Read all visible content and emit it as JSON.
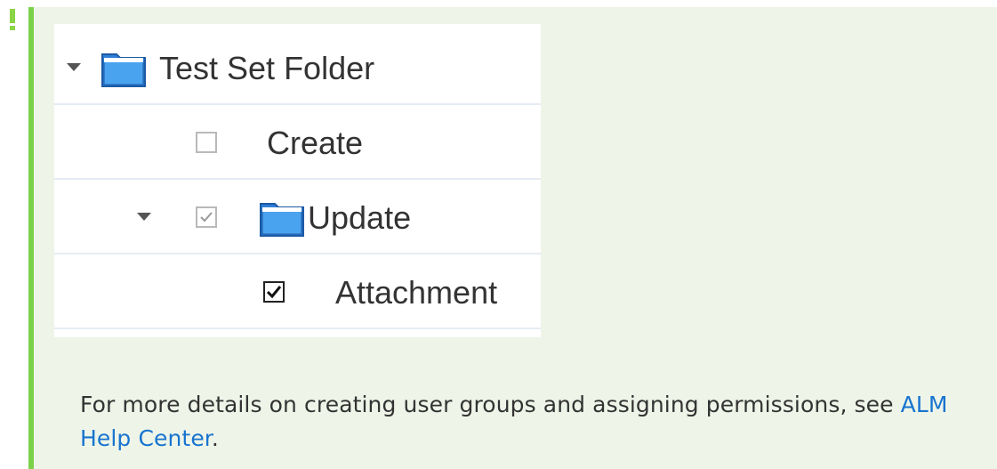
{
  "note": {
    "text_before_link": "For more details on creating user groups and assigning permissions, see ",
    "link_text": "ALM Help Center",
    "text_after_link": "."
  },
  "tree": {
    "items": [
      {
        "label": "Test Set Folder",
        "level": 0,
        "expanded": true,
        "checkbox": "none",
        "icon": "folder-icon"
      },
      {
        "label": "Create",
        "level": 1,
        "expanded": false,
        "checkbox": "unchecked",
        "icon": ""
      },
      {
        "label": "Update",
        "level": 1,
        "expanded": true,
        "checkbox": "checked-disabled",
        "icon": "folder-icon"
      },
      {
        "label": "Attachment",
        "level": 2,
        "expanded": false,
        "checkbox": "checked",
        "icon": ""
      }
    ]
  },
  "colors": {
    "note_background": "#eef5e8",
    "note_border": "#7bd24a",
    "link": "#1874d0",
    "text": "#333333"
  }
}
